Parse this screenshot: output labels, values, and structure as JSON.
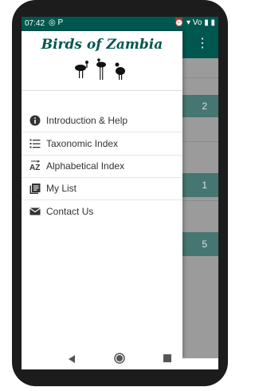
{
  "status": {
    "time": "07:42",
    "left_icons": "◎ P",
    "right_icons": "⏰ ▾ Vo ▮ ▮"
  },
  "app": {
    "title": "Birds of Zambia",
    "list_counts": [
      "2",
      "1",
      "5"
    ],
    "menu": [
      {
        "icon": "info-icon",
        "label": "Introduction & Help"
      },
      {
        "icon": "list-numbered-icon",
        "label": "Taxonomic Index"
      },
      {
        "icon": "sort-az-icon",
        "label": "Alphabetical Index"
      },
      {
        "icon": "book-icon",
        "label": "My List"
      },
      {
        "icon": "mail-icon",
        "label": "Contact Us"
      }
    ]
  },
  "colors": {
    "primary": "#00574f",
    "overlay": "#9b9b9b"
  }
}
